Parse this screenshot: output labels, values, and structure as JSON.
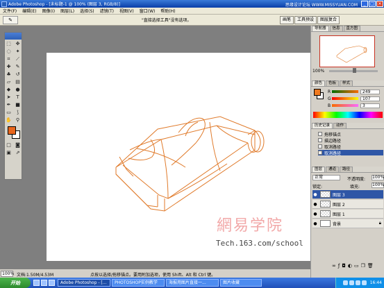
{
  "window": {
    "title": "Adobe Photoshop - [未标题-1 @ 100% (图层 3, RGB/8)]",
    "watermark": "思缘设计论坛  WWW.MISSYUAN.COM"
  },
  "menu": [
    "文件(F)",
    "编辑(E)",
    "图像(I)",
    "图层(L)",
    "选择(S)",
    "滤镜(T)",
    "视图(V)",
    "窗口(W)",
    "帮助(H)"
  ],
  "options": {
    "tool_glyph": "✎",
    "hint": "\"直接选择工具\"没有选项。"
  },
  "palette_well": [
    "画笔",
    "工具预设",
    "图层复合"
  ],
  "navigator": {
    "tabs": [
      "导航器",
      "信息",
      "直方图"
    ],
    "zoom": "100%"
  },
  "color": {
    "tabs": [
      "颜色",
      "色板",
      "样式"
    ],
    "fg": "#f07a20",
    "rows": [
      {
        "label": "R",
        "value": "249"
      },
      {
        "label": "G",
        "value": "107"
      },
      {
        "label": "B",
        "value": "3"
      }
    ]
  },
  "history": {
    "tabs": [
      "历史记录",
      "动作"
    ],
    "items": [
      "拖移锚点",
      "描边路径",
      "取消路径",
      "取消路径"
    ]
  },
  "layers": {
    "tabs": [
      "图层",
      "通道",
      "路径"
    ],
    "mode": "正常",
    "opacity_label": "不透明度:",
    "opacity": "100%",
    "lock_label": "锁定:",
    "fill_label": "填充:",
    "fill": "100%",
    "rows": [
      {
        "name": "图层 3"
      },
      {
        "name": "图层 2"
      },
      {
        "name": "图层 1"
      },
      {
        "name": "背景"
      }
    ]
  },
  "status": {
    "zoom": "100%",
    "doc": "文档:1.50M/4.53M",
    "hint": "点按以选择/拖移锚点。要用附加选项，使用 Shift、Alt 和 Ctrl 键。"
  },
  "watermark_site": {
    "cn": "網易学院",
    "url": "Tech.163.com/school"
  },
  "taskbar": {
    "start": "开始",
    "buttons": [
      "Adobe Photoshop - [...",
      "PHOTOSHOP实例教学",
      "海报用图片直接一...",
      "图片收藏"
    ],
    "clock": "16:44"
  }
}
